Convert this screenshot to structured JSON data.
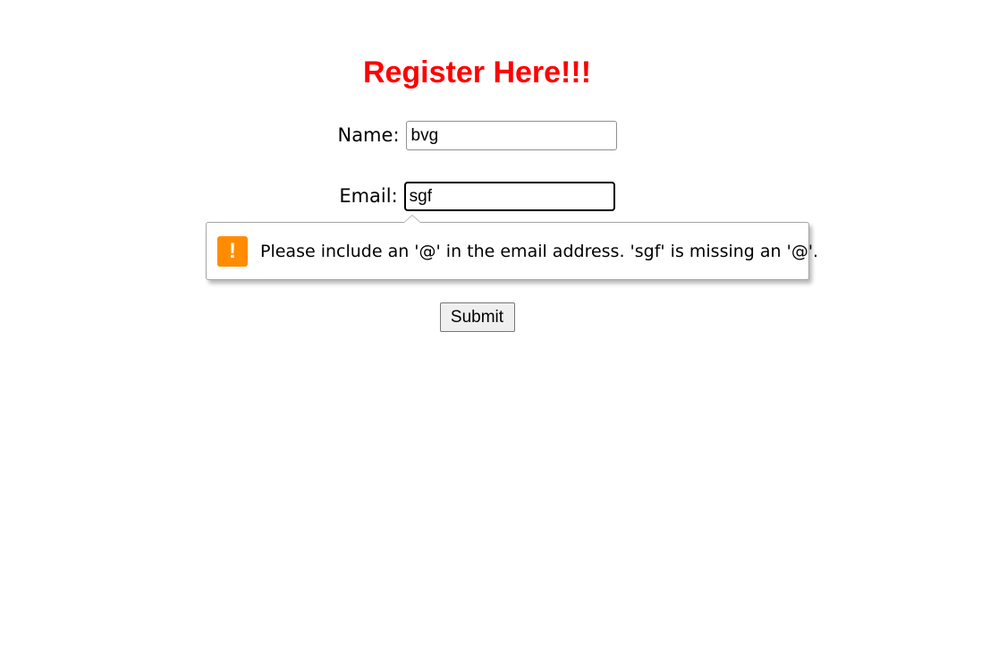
{
  "page": {
    "title": "Register Here!!!"
  },
  "form": {
    "name_label": "Name:",
    "name_value": "bvg",
    "email_label": "Email:",
    "email_value": "sgf",
    "submit_label": "Submit"
  },
  "validation": {
    "icon": "warning-icon",
    "icon_glyph": "!",
    "icon_color": "#ff8c00",
    "message": "Please include an '@' in the email address. 'sgf' is missing an '@'."
  },
  "colors": {
    "title": "#ff0000",
    "page_background": "#ffffff"
  }
}
